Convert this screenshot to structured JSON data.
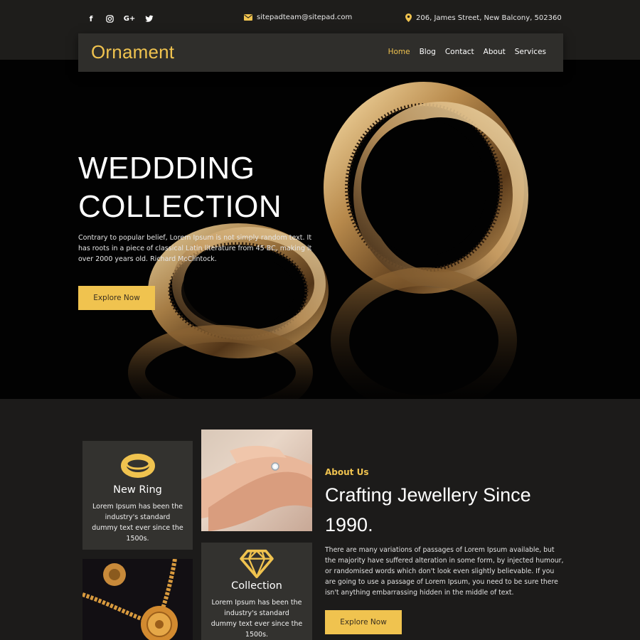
{
  "topbar": {
    "socials": [
      {
        "icon": "facebook-icon",
        "glyph": "f"
      },
      {
        "icon": "instagram-icon",
        "glyph": "◎"
      },
      {
        "icon": "google-plus-icon",
        "glyph": "G+"
      },
      {
        "icon": "twitter-icon",
        "glyph": "🐦"
      }
    ],
    "email": "sitepadteam@sitepad.com",
    "address": "206, James Street, New Balcony, 502360"
  },
  "navbar": {
    "logo": "Ornament",
    "links": [
      "Home",
      "Blog",
      "Contact",
      "About",
      "Services"
    ],
    "active": "Home"
  },
  "hero": {
    "title_line1": "WEDDDING",
    "title_line2": "COLLECTION",
    "text": "Contrary to popular belief, Lorem Ipsum is not simply random text. It has roots in a piece of classical Latin literature from 45 BC, making it over 2000 years old. Richard McClintock.",
    "button": "Explore Now"
  },
  "cards": [
    {
      "icon": "ring-icon",
      "title": "New Ring",
      "text": "Lorem Ipsum has been the industry's standard dummy text ever since the 1500s."
    },
    {
      "icon": "diamond-icon",
      "title": "Collection",
      "text": "Lorem Ipsum has been the industry's standard dummy text ever since the 1500s."
    }
  ],
  "about": {
    "label": "About Us",
    "title": "Crafting Jewellery Since 1990.",
    "text": "There are many variations of passages of Lorem Ipsum available, but the majority have suffered alteration in some form, by injected humour, or randomised words which don't look even slightly believable. If you are going to use a passage of Lorem Ipsum, you need to be sure there isn't anything embarrassing hidden in the middle of text.",
    "button": "Explore Now"
  },
  "colors": {
    "accent": "#f0c34f",
    "background": "#1c1b1a",
    "card": "#33322f",
    "hero": "#020202"
  }
}
